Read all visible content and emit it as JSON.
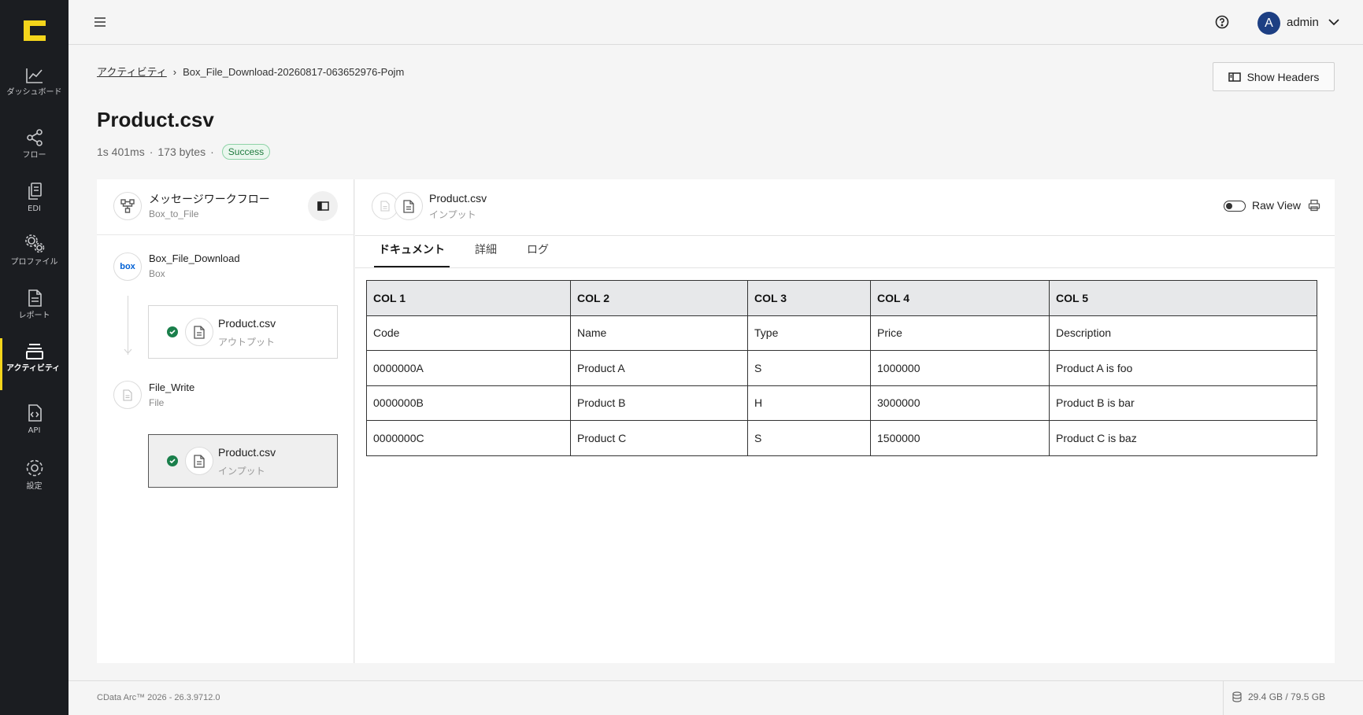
{
  "sidebar": {
    "items": [
      {
        "label": "ダッシュボード",
        "icon": "chart-line-icon"
      },
      {
        "label": "フロー",
        "icon": "share-nodes-icon"
      },
      {
        "label": "EDI",
        "icon": "documents-icon"
      },
      {
        "label": "プロファイル",
        "icon": "gears-icon"
      },
      {
        "label": "レポート",
        "icon": "report-icon"
      },
      {
        "label": "アクティビティ",
        "icon": "stack-icon",
        "active": true
      },
      {
        "label": "API",
        "icon": "code-file-icon"
      },
      {
        "label": "設定",
        "icon": "settings-gear-icon"
      }
    ]
  },
  "topbar": {
    "avatar_initial": "A",
    "username": "admin"
  },
  "breadcrumb": {
    "link": "アクティビティ",
    "separator": "›",
    "current": "Box_File_Download-20260817-063652976-Pojm"
  },
  "header": {
    "show_headers_label": "Show Headers",
    "title": "Product.csv",
    "duration": "1s 401ms",
    "dot": "·",
    "size": "173 bytes",
    "status": "Success"
  },
  "workflow": {
    "title": "メッセージワークフロー",
    "subtitle": "Box_to_File",
    "nodes": [
      {
        "name": "Box_File_Download",
        "type": "Box",
        "logo_text": "box",
        "file": {
          "name": "Product.csv",
          "direction": "アウトプット"
        }
      },
      {
        "name": "File_Write",
        "type": "File",
        "file": {
          "name": "Product.csv",
          "direction": "インプット"
        }
      }
    ]
  },
  "document": {
    "title": "Product.csv",
    "subtitle": "インプット",
    "raw_view_label": "Raw View",
    "raw_view_on": false,
    "tabs": [
      "ドキュメント",
      "詳細",
      "ログ"
    ],
    "active_tab": 0
  },
  "table": {
    "headers": [
      "COL 1",
      "COL 2",
      "COL 3",
      "COL 4",
      "COL 5"
    ],
    "rows": [
      [
        "Code",
        "Name",
        "Type",
        "Price",
        "Description"
      ],
      [
        "0000000A",
        "Product A",
        "S",
        "1000000",
        "Product A is foo"
      ],
      [
        "0000000B",
        "Product B",
        "H",
        "3000000",
        "Product B is bar"
      ],
      [
        "0000000C",
        "Product C",
        "S",
        "1500000",
        "Product C is baz"
      ]
    ]
  },
  "footer": {
    "version": "CData Arc™ 2026 - 26.3.9712.0",
    "storage": "29.4 GB / 79.5 GB"
  },
  "colors": {
    "sidebar_bg": "#1b1d21",
    "accent_yellow": "#f4d51b",
    "avatar_blue": "#1d3f83",
    "success_green": "#1a7f4b"
  }
}
